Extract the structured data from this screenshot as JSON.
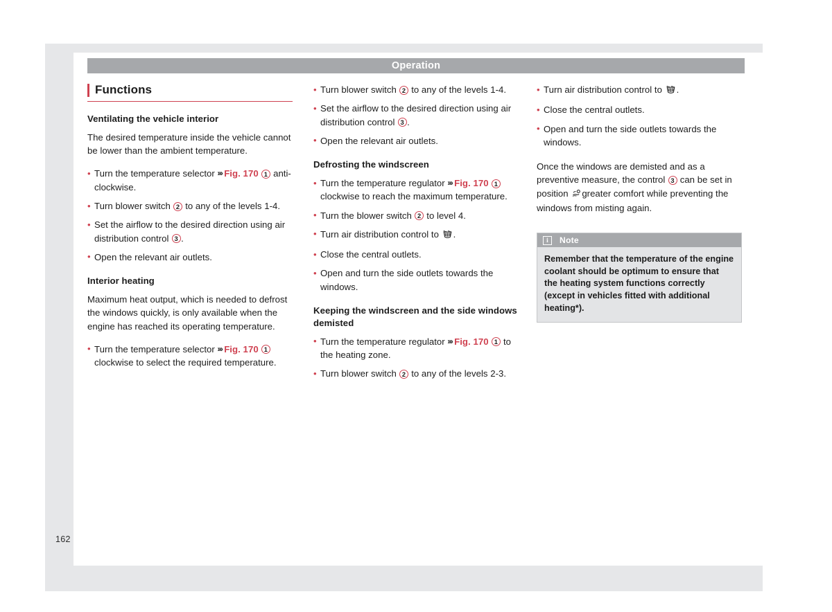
{
  "header": {
    "title": "Operation"
  },
  "page": {
    "number": "162"
  },
  "section": {
    "title": "Functions"
  },
  "icons": {
    "note": "info-icon",
    "defrost": "windscreen-defrost-icon",
    "windscreen_footwell": "windscreen-footwell-air-icon",
    "chevrons": "›››"
  },
  "colors": {
    "accent_red": "#cf4150",
    "header_gray": "#a6a8ab",
    "note_body_bg": "#e3e4e6",
    "page_bg": "#e6e7e9"
  },
  "column1": {
    "heading_ventilating": "Ventilating the vehicle interior",
    "para_ventilating": "The desired temperature inside the vehicle cannot be lower than the ambient temperature.",
    "bullets": [
      {
        "pre": "Turn the temperature selector",
        "figref": "Fig. 170",
        "circle": "1",
        "post": "anti-clockwise."
      },
      {
        "pre": "Turn blower switch",
        "circle": "2",
        "post": "to any of the levels 1-4."
      },
      {
        "pre": "Set the airflow to the desired direction using air distribution control",
        "circle": "3",
        "post": "."
      },
      {
        "pre": "Open the relevant air outlets."
      }
    ],
    "heading_heating": "Interior heating",
    "para_heating": "Maximum heat output, which is needed to defrost the windows quickly, is only available when the engine has reached its operating temperature.",
    "bullets2": [
      {
        "pre": "Turn the temperature selector",
        "figref": "Fig. 170",
        "circle": "1",
        "post": "clockwise to select the required temperature."
      }
    ]
  },
  "column2": {
    "bullets_top": [
      {
        "pre": "Turn blower switch",
        "circle": "2",
        "post": "to any of the levels 1-4."
      },
      {
        "pre": "Set the airflow to the desired direction using air distribution control",
        "circle": "3",
        "post": "."
      },
      {
        "pre": "Open the relevant air outlets."
      }
    ],
    "heading_defrosting": "Defrosting the windscreen",
    "bullets_defrost": [
      {
        "pre": "Turn the temperature regulator",
        "figref": "Fig. 170",
        "circle": "1",
        "post": "clockwise to reach the maximum temperature."
      },
      {
        "pre": "Turn the blower switch",
        "circle": "2",
        "post": "to level 4."
      },
      {
        "pre": "Turn air distribution control to",
        "icon": "windscreen-defrost-icon",
        "post": "."
      },
      {
        "pre": "Close the central outlets."
      },
      {
        "pre": "Open and turn the side outlets towards the windows."
      }
    ],
    "heading_demisted": "Keeping the windscreen and the side windows demisted",
    "bullets_demist": [
      {
        "pre": "Turn the temperature regulator",
        "figref": "Fig. 170",
        "circle": "1",
        "post": "to the heating zone."
      },
      {
        "pre": "Turn blower switch",
        "circle": "2",
        "post": "to any of the levels 2-3."
      }
    ]
  },
  "column3": {
    "bullets": [
      {
        "pre": "Turn air distribution control to",
        "icon": "windscreen-defrost-icon",
        "post": "."
      },
      {
        "pre": "Close the central outlets."
      },
      {
        "pre": "Open and turn the side outlets towards the windows."
      }
    ],
    "para_a": "Once the windows are demisted and as a preventive measure, the control",
    "para_circle": "3",
    "para_b": "can be set in position",
    "para_c": "greater comfort while preventing the windows from misting again.",
    "note": {
      "label": "Note",
      "body": "Remember that the temperature of the engine coolant should be optimum to ensure that the heating system functions correctly (except in vehicles fitted with additional heating*)."
    }
  }
}
